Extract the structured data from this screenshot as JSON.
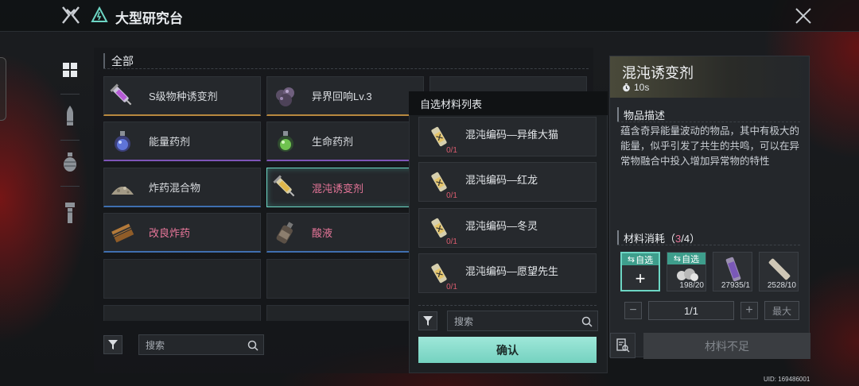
{
  "header": {
    "title": "大型研究台"
  },
  "category": {
    "title": "全部"
  },
  "items": [
    {
      "label": "S级物种诱变剂",
      "icon": "syringe-icon"
    },
    {
      "label": "异界回响Lv.3",
      "icon": "crystal-cluster-icon"
    },
    {
      "label": "",
      "icon": "syringe-icon"
    },
    {
      "label": "能量药剂",
      "icon": "potion-flask-icon"
    },
    {
      "label": "生命药剂",
      "icon": "green-potion-icon"
    },
    {
      "label": "炸药混合物",
      "icon": "powder-pile-icon"
    },
    {
      "label": "混沌诱变剂",
      "icon": "syringe-icon"
    },
    {
      "label": "改良炸药",
      "icon": "explosive-bricks-icon"
    },
    {
      "label": "酸液",
      "icon": "acid-bottle-icon"
    }
  ],
  "search": {
    "placeholder": "搜索"
  },
  "popup": {
    "title": "自选材料列表",
    "items": [
      {
        "label": "混沌编码—异维大猫",
        "count": "0/1"
      },
      {
        "label": "混沌编码—红龙",
        "count": "0/1"
      },
      {
        "label": "混沌编码—冬灵",
        "count": "0/1"
      },
      {
        "label": "混沌编码—愿望先生",
        "count": "0/1"
      }
    ],
    "search_placeholder": "搜索",
    "confirm": "确认"
  },
  "detail": {
    "title": "混沌诱变剂",
    "time": "10s",
    "desc_title": "物品描述",
    "description": "蕴含奇异能量波动的物品，其中有极大的能量，似乎引发了共生的共鸣，可以在异常物融合中投入增加异常物的特性",
    "materials_label": "材料消耗（",
    "materials_have": "3",
    "materials_total": "/4）",
    "materials": [
      {
        "tag": "自选",
        "qty": ""
      },
      {
        "tag": "自选",
        "qty": "198/20"
      },
      {
        "tag": "",
        "qty": "27935/1"
      },
      {
        "tag": "",
        "qty": "2528/10"
      }
    ],
    "quantity": "1/1",
    "max_label": "最大",
    "insufficient": "材料不足"
  },
  "uid": "UID: 169486001",
  "colors": {
    "accent": "#6dd6c4",
    "warning": "#e8769a"
  }
}
